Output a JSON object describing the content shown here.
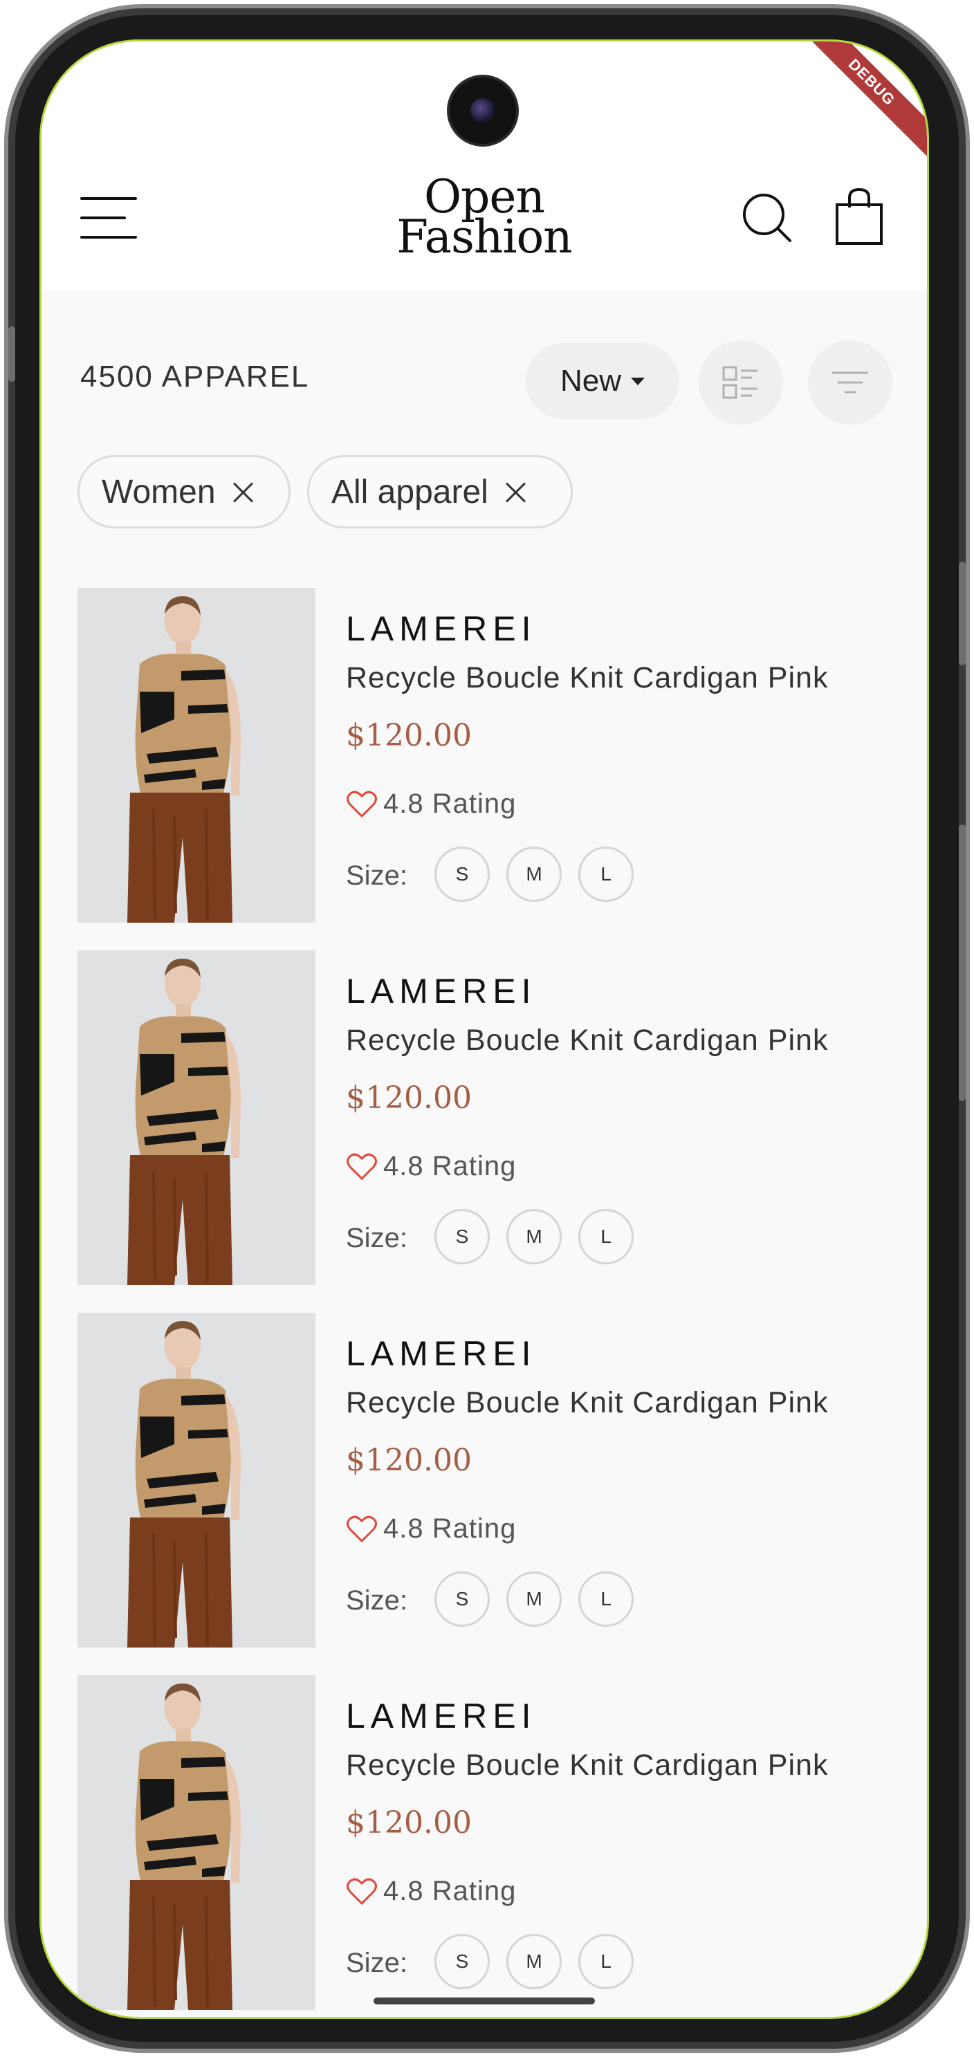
{
  "header": {
    "logo_line1": "Open",
    "logo_line2": "Fashion",
    "debug_banner": "DEBUG"
  },
  "toolbar": {
    "count": "4500 APPAREL",
    "sort_label": "New",
    "icons": [
      "menu-icon",
      "search-icon",
      "shopping-bag-icon",
      "list-view-icon",
      "filter-icon",
      "caret-down-icon"
    ]
  },
  "filters": {
    "chips": [
      {
        "label": "Women"
      },
      {
        "label": "All apparel"
      }
    ]
  },
  "products": [
    {
      "brand": "LAMEREI",
      "name": "Recycle Boucle Knit Cardigan Pink",
      "price": "$120.00",
      "rating": "4.8 Rating",
      "size_label": "Size:",
      "sizes": [
        "S",
        "M",
        "L"
      ]
    },
    {
      "brand": "LAMEREI",
      "name": "Recycle Boucle Knit Cardigan Pink",
      "price": "$120.00",
      "rating": "4.8 Rating",
      "size_label": "Size:",
      "sizes": [
        "S",
        "M",
        "L"
      ]
    },
    {
      "brand": "LAMEREI",
      "name": "Recycle Boucle Knit Cardigan Pink",
      "price": "$120.00",
      "rating": "4.8 Rating",
      "size_label": "Size:",
      "sizes": [
        "S",
        "M",
        "L"
      ]
    },
    {
      "brand": "LAMEREI",
      "name": "Recycle Boucle Knit Cardigan Pink",
      "price": "$120.00",
      "rating": "4.8 Rating",
      "size_label": "Size:",
      "sizes": [
        "S",
        "M",
        "L"
      ]
    }
  ],
  "colors": {
    "price": "#a55e45",
    "heart": "#e04a3a",
    "background": "#f9f9f9"
  }
}
